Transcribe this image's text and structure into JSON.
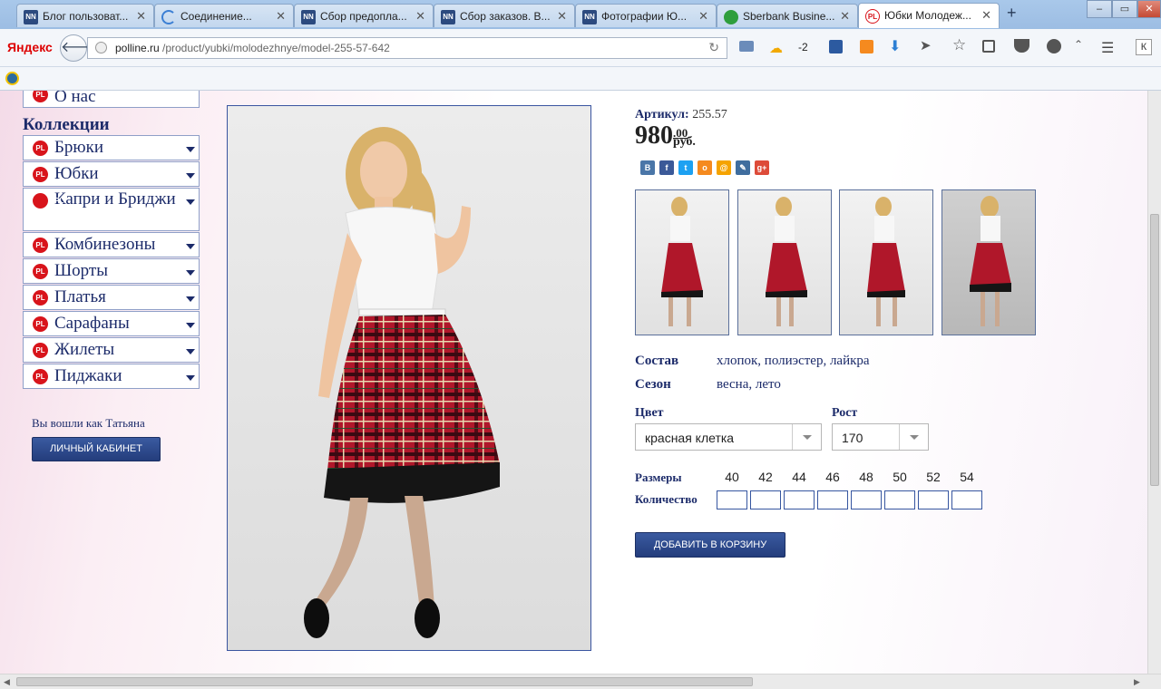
{
  "browser": {
    "tabs": [
      {
        "label": "Блог пользоват...",
        "icon": "NN",
        "icon_color": "#2c4a7f"
      },
      {
        "label": "Соединение...",
        "icon": "spinner",
        "icon_color": "#3b7fd4"
      },
      {
        "label": "Сбор предопла...",
        "icon": "NN",
        "icon_color": "#2c4a7f"
      },
      {
        "label": "Сбор заказов. В...",
        "icon": "NN",
        "icon_color": "#2c4a7f"
      },
      {
        "label": "Фотографии Ю...",
        "icon": "NN",
        "icon_color": "#2c4a7f"
      },
      {
        "label": "Sberbank Busine...",
        "icon": "sber",
        "icon_color": "#2e9e3d"
      },
      {
        "label": "Юбки Молодеж...",
        "icon": "PL",
        "icon_color": "#d8141b"
      }
    ],
    "new_tab": "+",
    "window_controls": {
      "minimize": "–",
      "maximize": "▭",
      "close": "✕"
    },
    "logo": "Яндекс",
    "url_host": "polline.ru",
    "url_path": "/product/yubki/molodezhnye/model-255-57-642",
    "weather_temp": "-2",
    "toolbar_k": "К"
  },
  "sidebar": {
    "about": "О нас",
    "collections_title": "Коллекции",
    "badge": "PL",
    "items": [
      {
        "label": "Брюки"
      },
      {
        "label": "Юбки"
      },
      {
        "label": "Капри и Бриджи"
      },
      {
        "label": "Комбинезоны"
      },
      {
        "label": "Шорты"
      },
      {
        "label": "Платья"
      },
      {
        "label": "Сарафаны"
      },
      {
        "label": "Жилеты"
      },
      {
        "label": "Пиджаки"
      }
    ],
    "logged_in_text": "Вы вошли как Татьяна",
    "cabinet_button": "ЛИЧНЫЙ КАБИНЕТ"
  },
  "product": {
    "article_label": "Артикул:",
    "article_value": "255.57",
    "price_main": "980",
    "price_cents": ".00",
    "price_currency": "руб.",
    "social": [
      {
        "icon": "vk-icon",
        "glyph": "В",
        "color": "#4a76a8"
      },
      {
        "icon": "facebook-icon",
        "glyph": "f",
        "color": "#3b5998"
      },
      {
        "icon": "twitter-icon",
        "glyph": "t",
        "color": "#1da1f2"
      },
      {
        "icon": "odnoklassniki-icon",
        "glyph": "о",
        "color": "#f58a1f"
      },
      {
        "icon": "mailru-icon",
        "glyph": "@",
        "color": "#f5a300"
      },
      {
        "icon": "livejournal-icon",
        "glyph": "✎",
        "color": "#3f6d9e"
      },
      {
        "icon": "googleplus-icon",
        "glyph": "g+",
        "color": "#dd4b39"
      }
    ],
    "composition_label": "Состав",
    "composition_value": "хлопок, полиэстер, лайкра",
    "season_label": "Сезон",
    "season_value": "весна, лето",
    "color_label": "Цвет",
    "color_value": "красная клетка",
    "height_label": "Рост",
    "height_value": "170",
    "sizes_label": "Размеры",
    "sizes": [
      "40",
      "42",
      "44",
      "46",
      "48",
      "50",
      "52",
      "54"
    ],
    "quantity_label": "Количество",
    "add_to_cart": "ДОБАВИТЬ В КОРЗИНУ"
  }
}
